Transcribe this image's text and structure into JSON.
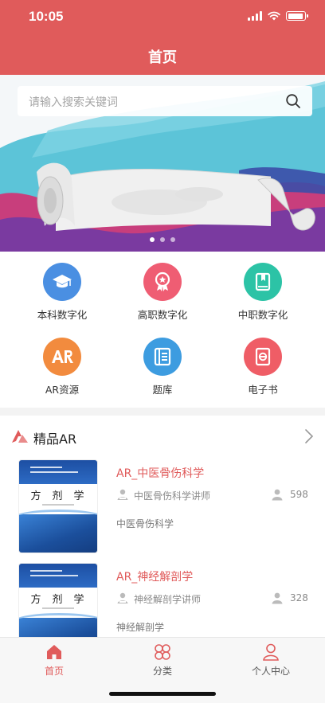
{
  "status_bar": {
    "time": "10:05",
    "battery_level": 0.9
  },
  "nav": {
    "title": "首页"
  },
  "search": {
    "placeholder": "请输入搜索关键词"
  },
  "banner": {
    "dot_count": 3,
    "active_dot": 0
  },
  "categories": [
    {
      "label": "本科数字化",
      "icon": "graduation-cap-icon",
      "color": "#4a8fe2"
    },
    {
      "label": "高职数字化",
      "icon": "award-medal-icon",
      "color": "#ef5d73"
    },
    {
      "label": "中职数字化",
      "icon": "book-bookmark-icon",
      "color": "#2cc3a6"
    },
    {
      "label": "AR资源",
      "icon": "ar-icon",
      "color": "#f28b3e"
    },
    {
      "label": "题库",
      "icon": "question-bank-icon",
      "color": "#3d9ce0"
    },
    {
      "label": "电子书",
      "icon": "ebook-icon",
      "color": "#ef5d66"
    }
  ],
  "section": {
    "title": "精品AR",
    "books": [
      {
        "title": "AR_中医骨伤科学",
        "author": "中医骨伤科学讲师",
        "count": "598",
        "desc": "中医骨伤科学",
        "cover_title": "方剂学"
      },
      {
        "title": "AR_神经解剖学",
        "author": "神经解剖学讲师",
        "count": "328",
        "desc": "神经解剖学",
        "cover_title": "方剂学"
      }
    ]
  },
  "tabbar": {
    "tabs": [
      {
        "label": "首页",
        "icon": "home-icon",
        "active": true
      },
      {
        "label": "分类",
        "icon": "category-icon",
        "active": false
      },
      {
        "label": "个人中心",
        "icon": "user-icon",
        "active": false
      }
    ]
  },
  "colors": {
    "primary": "#e05b5b",
    "text": "#333333",
    "muted": "#8a8a8a"
  }
}
